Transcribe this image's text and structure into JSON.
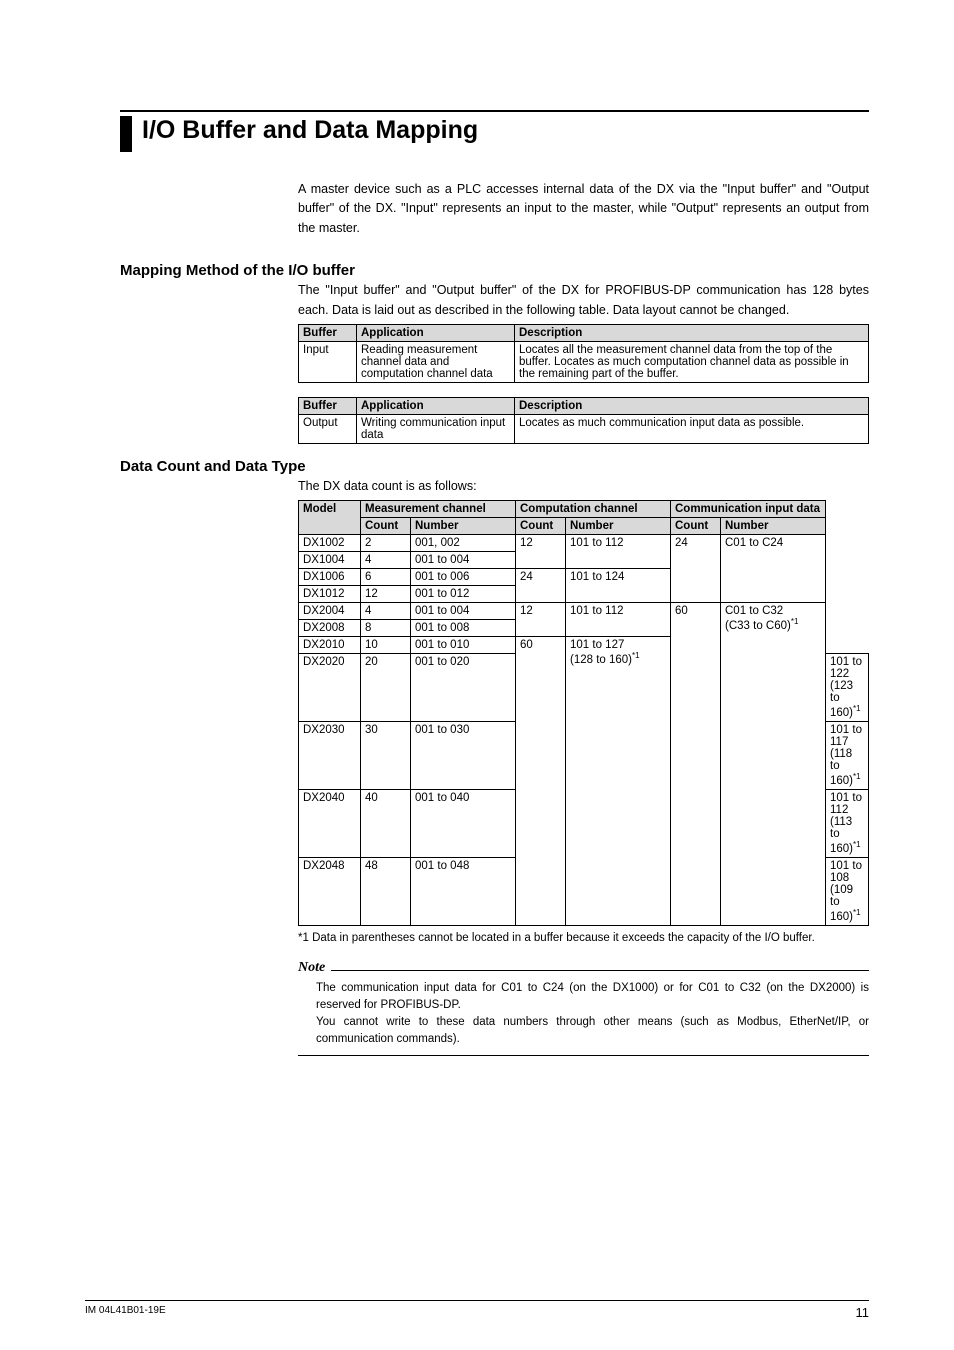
{
  "title": "I/O Buffer and Data Mapping",
  "intro": "A master device such as a PLC accesses internal data of the DX via the \"Input buffer\" and \"Output buffer\" of the DX. \"Input\" represents an input to the master, while \"Output\" represents an output from the master.",
  "section1": {
    "heading": "Mapping Method of the I/O buffer",
    "sub": "The \"Input buffer\" and \"Output buffer\" of the DX for PROFIBUS-DP communication has 128 bytes each. Data is laid out as described in the following table. Data layout cannot be changed.",
    "table1": {
      "headers": [
        "Buffer",
        "Application",
        "Description"
      ],
      "row": {
        "buffer": "Input",
        "application": "Reading measurement channel data and computation channel data",
        "description": "Locates all the measurement channel data from the top of the buffer. Locates as much computation channel data as possible in the remaining part of the buffer."
      }
    },
    "table2": {
      "headers": [
        "Buffer",
        "Application",
        "Description"
      ],
      "row": {
        "buffer": "Output",
        "application": "Writing communication input data",
        "description": "Locates as much communication input data as possible."
      }
    }
  },
  "section2": {
    "heading": "Data Count and Data Type",
    "sub": "The DX data count is as follows:",
    "headers": {
      "model": "Model",
      "meas": "Measurement channel",
      "comp": "Computation channel",
      "comm": "Communication input data",
      "count": "Count",
      "number": "Number"
    },
    "rows": [
      {
        "model": "DX1002",
        "mc": "2",
        "mn": "001, 002",
        "cc": "12",
        "cn": "101 to 112",
        "ic": "24",
        "in": "C01 to C24",
        "span_comp": 2,
        "span_comm": 4,
        "in_sup": ""
      },
      {
        "model": "DX1004",
        "mc": "4",
        "mn": "001 to 004"
      },
      {
        "model": "DX1006",
        "mc": "6",
        "mn": "001 to 006",
        "cc": "24",
        "cn": "101 to 124",
        "span_comp": 2
      },
      {
        "model": "DX1012",
        "mc": "12",
        "mn": "001 to 012"
      },
      {
        "model": "DX2004",
        "mc": "4",
        "mn": "001 to 004",
        "cc": "12",
        "cn": "101 to 112",
        "span_comp": 2,
        "ic": "60",
        "in": "C01 to C32",
        "in2": "(C33 to C60)",
        "in_sup": "*1",
        "span_comm": 7
      },
      {
        "model": "DX2008",
        "mc": "8",
        "mn": "001 to 008"
      },
      {
        "model": "DX2010",
        "mc": "10",
        "mn": "001 to 010",
        "cc": "60",
        "cn": "101 to 127",
        "cn2": "(128 to 160)",
        "cn_sup": "*1",
        "span_comp": 5
      },
      {
        "model": "DX2020",
        "mc": "20",
        "mn": "001 to 020",
        "cn": "101 to 122",
        "cn2": "(123 to 160)",
        "cn_sup": "*1"
      },
      {
        "model": "DX2030",
        "mc": "30",
        "mn": "001 to 030",
        "cn": "101 to 117",
        "cn2": "(118 to 160)",
        "cn_sup": "*1"
      },
      {
        "model": "DX2040",
        "mc": "40",
        "mn": "001 to 040",
        "cn": "101 to 112",
        "cn2": "(113 to 160)",
        "cn_sup": "*1"
      },
      {
        "model": "DX2048",
        "mc": "48",
        "mn": "001 to 048",
        "cn": "101 to 108",
        "cn2": "(109 to 160)",
        "cn_sup": "*1"
      }
    ],
    "footnote": "*1 Data in parentheses cannot be located in a buffer because it exceeds the capacity of the I/O buffer."
  },
  "note": {
    "label": "Note",
    "body1": "The communication input data for C01 to C24 (on the DX1000) or for C01 to C32 (on the DX2000) is reserved for PROFIBUS-DP.",
    "body2": "You cannot write to these data numbers through other means (such as Modbus, EtherNet/IP, or communication commands)."
  },
  "footer": {
    "left": "IM 04L41B01-19E",
    "right": "11"
  }
}
